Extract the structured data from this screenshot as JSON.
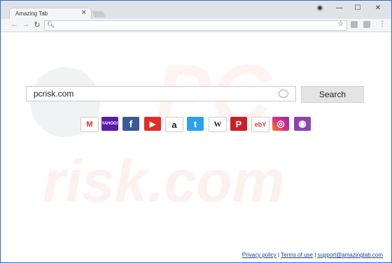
{
  "tab": {
    "title": "Amazing Tab",
    "close": "✕"
  },
  "window": {
    "account": "◉",
    "minimize": "—",
    "maximize": "☐",
    "close": "✕"
  },
  "nav": {
    "back": "←",
    "forward": "→",
    "reload": "↻",
    "menu": "⋮"
  },
  "omnibox": {
    "value": "",
    "star": "☆"
  },
  "search": {
    "value": "pcrisk.com",
    "button": "Search"
  },
  "shortcuts": [
    {
      "name": "gmail",
      "glyph": "M",
      "color": "#ffffff"
    },
    {
      "name": "yahoo",
      "glyph": "YAHOO!",
      "color": "#5b1bab"
    },
    {
      "name": "facebook",
      "glyph": "f",
      "color": "#3b5998"
    },
    {
      "name": "youtube",
      "glyph": "▶",
      "color": "#e52d27"
    },
    {
      "name": "amazon",
      "glyph": "a",
      "color": "#ffffff"
    },
    {
      "name": "twitter",
      "glyph": "t",
      "color": "#2aa3ef"
    },
    {
      "name": "wikipedia",
      "glyph": "W",
      "color": "#ffffff"
    },
    {
      "name": "pinterest",
      "glyph": "P",
      "color": "#cb2027"
    },
    {
      "name": "ebay",
      "glyph": "ebY",
      "color": "#ffffff"
    },
    {
      "name": "instagram",
      "glyph": "◎",
      "color": "#c13584"
    },
    {
      "name": "podcasts",
      "glyph": "◉",
      "color": "#8e44ad"
    }
  ],
  "footer": {
    "privacy": "Privacy policy",
    "sep1": " | ",
    "terms": "Terms of use",
    "sep2": " | ",
    "support": "support@amazingtab.com"
  },
  "watermark": {
    "line1": "PC",
    "line2": "risk.com"
  }
}
